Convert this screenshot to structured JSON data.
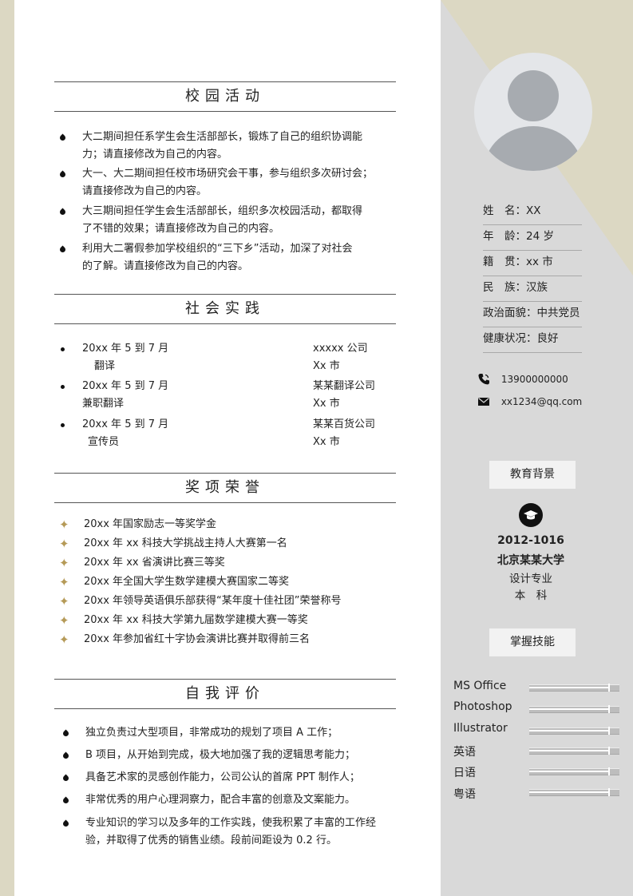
{
  "sections": {
    "campus": {
      "title": "校园活动",
      "items": [
        [
          "大二期间担任系学生会生活部部长，锻炼了自己的组织协调能",
          "力；请直接修改为自己的内容。"
        ],
        [
          "大一、大二期间担任校市场研究会干事，参与组织多次研讨会；",
          "请直接修改为自己的内容。"
        ],
        [
          "大三期间担任学生会生活部部长，组织多次校园活动，都取得",
          "了不错的效果；请直接修改为自己的内容。"
        ],
        [
          "利用大二署假参加学校组织的“三下乡”活动，加深了对社会",
          "的了解。请直接修改为自己的内容。"
        ]
      ]
    },
    "practice": {
      "title": "社会实践",
      "items": [
        {
          "date": "20xx 年 5 到 7 月",
          "role": "翻译",
          "company": "xxxxx 公司",
          "city": "Xx 市"
        },
        {
          "date": "20xx 年 5 到 7 月",
          "role": "兼职翻译",
          "company": "某某翻译公司",
          "city": "Xx 市"
        },
        {
          "date": "20xx 年 5 到 7 月",
          "role": "宣传员",
          "company": "某某百货公司",
          "city": "Xx 市"
        }
      ]
    },
    "awards": {
      "title": "奖项荣誉",
      "items": [
        "20xx 年国家励志一等奖学金",
        "20xx 年 xx 科技大学挑战主持人大赛第一名",
        "20xx 年 xx 省演讲比赛三等奖",
        "20xx 年全国大学生数学建模大赛国家二等奖",
        "20xx 年领导英语俱乐部获得“某年度十佳社团”荣誉称号",
        "20xx 年 xx 科技大学第九届数学建模大赛一等奖",
        "20xx 年参加省红十字协会演讲比赛并取得前三名"
      ]
    },
    "self": {
      "title": "自我评价",
      "items": [
        [
          "独立负责过大型项目，非常成功的规划了项目 A 工作；"
        ],
        [
          "B 项目，从开始到完成，极大地加强了我的逻辑思考能力；"
        ],
        [
          "具备艺术家的灵感创作能力，公司公认的首席 PPT 制作人；"
        ],
        [
          "非常优秀的用户心理洞察力，配合丰富的创意及文案能力。"
        ],
        [
          "专业知识的学习以及多年的工作实践，使我积累了丰富的工作经",
          "验，并取得了优秀的销售业绩。段前间距设为 0.2 行。"
        ]
      ]
    }
  },
  "profile": {
    "rows": [
      {
        "label": "姓　名：",
        "value": "XX"
      },
      {
        "label": "年　龄：",
        "value": "24 岁"
      },
      {
        "label": "籍　贯：",
        "value": "xx 市"
      },
      {
        "label": "民　族：",
        "value": "汉族"
      },
      {
        "label": "政治面貌：",
        "value": "中共党员"
      },
      {
        "label": "健康状况：",
        "value": "良好"
      }
    ],
    "phone": "13900000000",
    "email": "xx1234@qq.com"
  },
  "education": {
    "heading": "教育背景",
    "years": "2012-1016",
    "school": "北京某某大学",
    "major": "设计专业",
    "degree": "本　科"
  },
  "skills": {
    "heading": "掌握技能",
    "items": [
      {
        "name": "MS Office",
        "level": 0.88
      },
      {
        "name": "Photoshop",
        "level": 0.88
      },
      {
        "name": "Illustrator",
        "level": 0.88
      },
      {
        "name": "英语",
        "level": 0.88
      },
      {
        "name": "日语",
        "level": 0.88
      },
      {
        "name": "粤语",
        "level": 0.88
      }
    ]
  },
  "colors": {
    "accent": "#b59a57",
    "sidebar": "#d9d9d9",
    "beige": "#dcd8c3"
  },
  "icons": [
    "phone-icon",
    "envelope-icon",
    "graduation-cap-icon",
    "avatar-placeholder-icon"
  ]
}
